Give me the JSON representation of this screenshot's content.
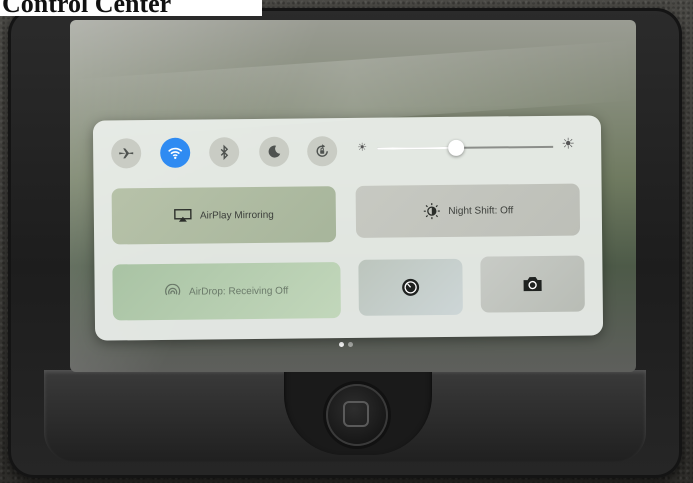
{
  "header": {
    "title": "Control Center"
  },
  "toggles": [
    {
      "name": "airplane-mode",
      "icon": "airplane-icon",
      "on": false
    },
    {
      "name": "wifi",
      "icon": "wifi-icon",
      "on": true
    },
    {
      "name": "bluetooth",
      "icon": "bluetooth-icon",
      "on": false
    },
    {
      "name": "do-not-disturb",
      "icon": "moon-icon",
      "on": false
    },
    {
      "name": "rotation-lock",
      "icon": "rotation-lock-icon",
      "on": false
    }
  ],
  "brightness": {
    "level": 0.45,
    "icon_low": "sun-small-icon",
    "icon_high": "sun-large-icon"
  },
  "tiles": {
    "airplay_label": "AirPlay Mirroring",
    "night_shift_label": "Night Shift: Off",
    "airdrop_label": "AirDrop: Receiving Off"
  },
  "shortcuts": [
    {
      "name": "timer",
      "icon": "timer-icon"
    },
    {
      "name": "camera",
      "icon": "camera-icon"
    }
  ],
  "pagination": {
    "count": 2,
    "active_index": 0
  },
  "colors": {
    "toggle_on": "#2f8bf2",
    "panel": "#ecf0ec"
  }
}
